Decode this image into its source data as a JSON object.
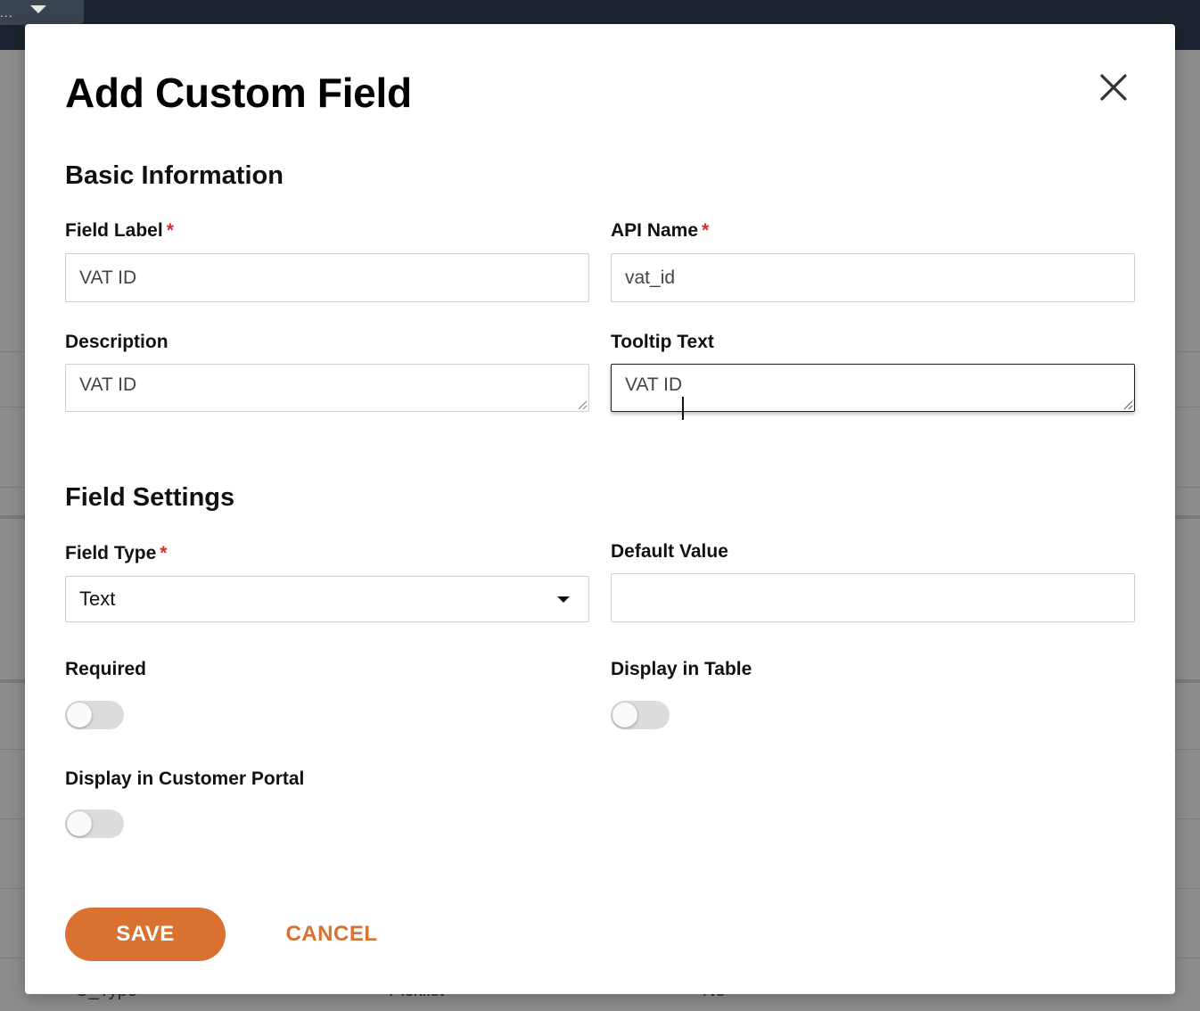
{
  "background": {
    "dots": "...",
    "bottom_row": [
      "O_Type",
      "Picklist",
      "No"
    ]
  },
  "modal": {
    "title": "Add Custom Field",
    "close_icon": "close-icon"
  },
  "basic_information": {
    "title": "Basic Information",
    "field_label": {
      "label": "Field Label",
      "required_mark": "*",
      "value": "VAT ID"
    },
    "api_name": {
      "label": "API Name",
      "required_mark": "*",
      "value": "vat_id"
    },
    "description": {
      "label": "Description",
      "value": "VAT ID"
    },
    "tooltip_text": {
      "label": "Tooltip Text",
      "value": "VAT ID"
    }
  },
  "field_settings": {
    "title": "Field Settings",
    "field_type": {
      "label": "Field Type",
      "required_mark": "*",
      "selected": "Text"
    },
    "default_value": {
      "label": "Default Value",
      "value": ""
    },
    "required": {
      "label": "Required",
      "on": false
    },
    "display_in_table": {
      "label": "Display in Table",
      "on": false
    },
    "display_in_customer_portal": {
      "label": "Display in Customer Portal",
      "on": false
    }
  },
  "actions": {
    "save_label": "SAVE",
    "cancel_label": "CANCEL"
  },
  "colors": {
    "accent": "#d97230",
    "required": "#d32f2f",
    "toggle_off": "#dcdcdc"
  }
}
